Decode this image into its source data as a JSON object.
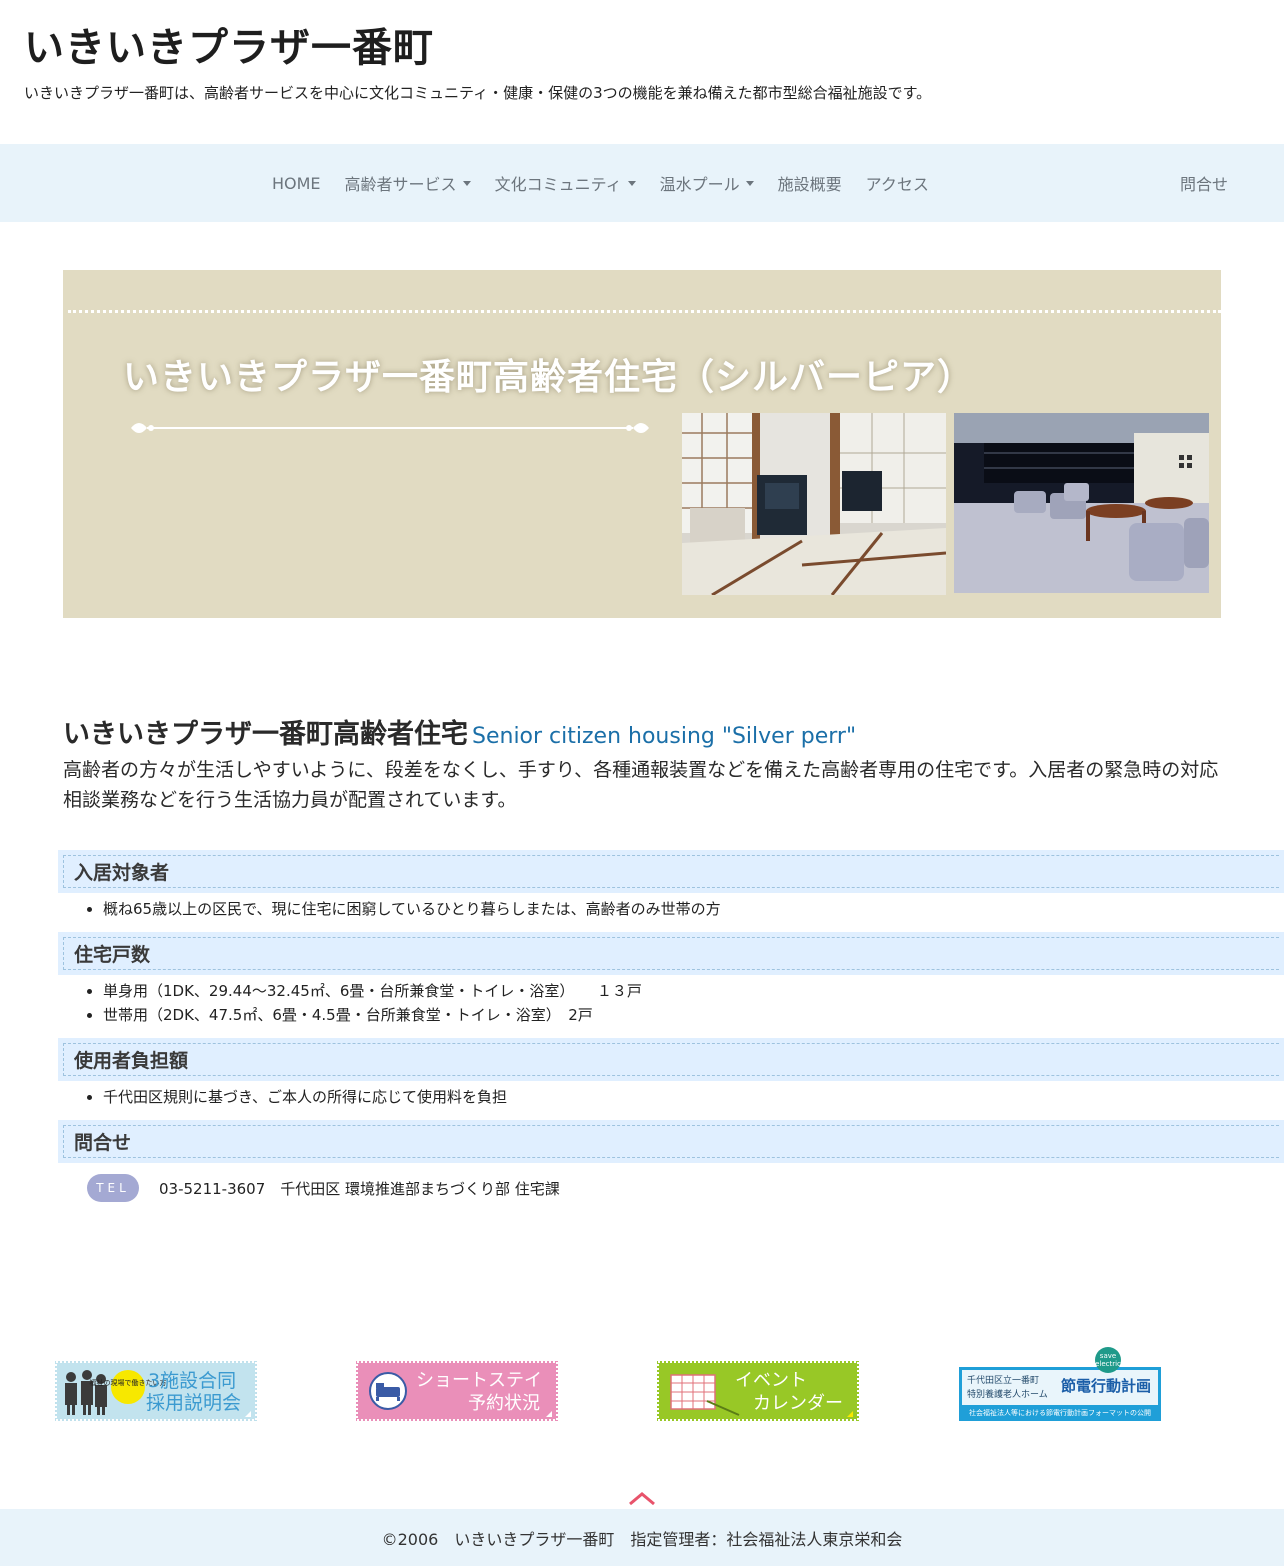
{
  "header": {
    "title": "いきいきプラザ一番町",
    "description": "いきいきプラザ一番町は、高齢者サービスを中心に文化コミュニティ・健康・保健の3つの機能を兼ね備えた都市型総合福祉施設です。"
  },
  "nav": {
    "items": [
      {
        "label": "HOME",
        "dropdown": false
      },
      {
        "label": "高齢者サービス",
        "dropdown": true
      },
      {
        "label": "文化コミュニティ",
        "dropdown": true
      },
      {
        "label": "温水プール",
        "dropdown": true
      },
      {
        "label": "施設概要",
        "dropdown": false
      },
      {
        "label": "アクセス",
        "dropdown": false
      }
    ],
    "contact": "問合せ"
  },
  "hero": {
    "title": "いきいきプラザ一番町高齢者住宅（シルバーピア）"
  },
  "intro": {
    "title": "いきいきプラザ一番町高齢者住宅",
    "subtitle_en": "Senior citizen housing \"Silver perr\"",
    "text_line1": "高齢者の方々が生活しやすいように、段差をなくし、手すり、各種通報装置などを備えた高齢者専用の住宅です。入居者の緊急時の対応",
    "text_line2": "相談業務などを行う生活協力員が配置されています。"
  },
  "sections": [
    {
      "heading": "入居対象者",
      "items": [
        "概ね65歳以上の区民で、現に住宅に困窮しているひとり暮らしまたは、高齢者のみ世帯の方"
      ]
    },
    {
      "heading": "住宅戸数",
      "items": [
        "単身用（1DK、29.44～32.45㎡、6畳・台所兼食堂・トイレ・浴室）　　１３戸",
        "世帯用（2DK、47.5㎡、6畳・4.5畳・台所兼食堂・トイレ・浴室）　2戸"
      ]
    },
    {
      "heading": "使用者負担額",
      "items": [
        "千代田区規則に基づき、ご本人の所得に応じて使用料を負担"
      ]
    },
    {
      "heading": "問合せ",
      "items": []
    }
  ],
  "contact": {
    "badge": "TEL",
    "text": "03-5211-3607　千代田区 環境推進部まちづくり部 住宅課"
  },
  "banners": {
    "recruit": {
      "small": "福祉の現場で働きたい方",
      "line1": "3施設合同",
      "line2": "採用説明会"
    },
    "shortstay": {
      "line1": "ショートステイ",
      "line2": "予約状況"
    },
    "event": {
      "line1": "イベント",
      "line2": "カレンダー"
    },
    "power": {
      "line1": "千代田区立一番町",
      "line2": "特別養護老人ホーム",
      "main": "節電行動計画",
      "bottom": "社会福祉法人等における節電行動計画フォーマットの公開",
      "badge1": "save",
      "badge2": "electric"
    }
  },
  "footer": {
    "text": "©2006　いきいきプラザ一番町　指定管理者：社会福祉法人東京栄和会"
  },
  "colors": {
    "nav_bg": "#e8f3fa",
    "hero_bg": "#e1dbc2",
    "section_bg": "#e0efff",
    "accent_blue": "#1b6fa8",
    "tel_badge": "#a4a9d3",
    "back_top": "#e8536b"
  }
}
